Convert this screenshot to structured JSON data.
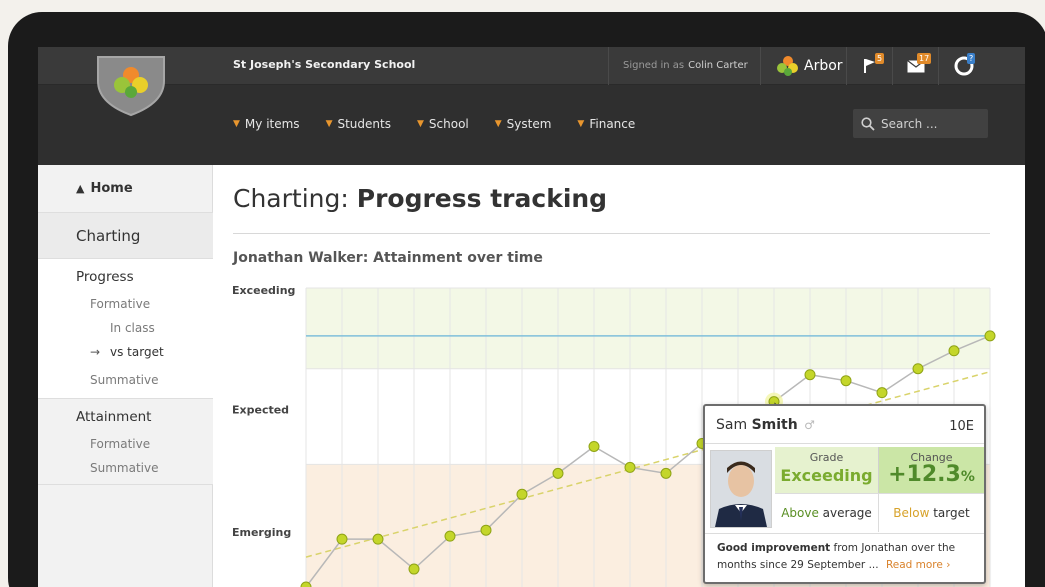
{
  "header": {
    "school_name": "St Joseph's Secondary School",
    "signed_in_label": "Signed in as",
    "user_name": "Colin Carter",
    "brand": "Arbor",
    "flag_count": "5",
    "mail_count": "17",
    "help_badge": "?"
  },
  "nav": {
    "items": [
      "My items",
      "Students",
      "School",
      "System",
      "Finance"
    ],
    "search_placeholder": "Search ..."
  },
  "sidebar": {
    "home": "Home",
    "section": "Charting",
    "progress": "Progress",
    "formative": "Formative",
    "in_class": "In class",
    "vs_target": "vs target",
    "summative": "Summative",
    "attainment": "Attainment",
    "attainment_formative": "Formative",
    "attainment_summative": "Summative"
  },
  "main": {
    "title_prefix": "Charting:",
    "title_bold": "Progress tracking",
    "chart_title": "Jonathan Walker: Attainment over time"
  },
  "chart_data": {
    "type": "line",
    "y_labels": [
      "Exceeding",
      "Expected",
      "Emerging"
    ],
    "ylim": [
      0,
      100
    ],
    "bands": [
      {
        "name": "Exceeding",
        "from": 73,
        "to": 100,
        "color": "#f3f8e6"
      },
      {
        "name": "Expected",
        "from": 41,
        "to": 73,
        "color": "#ffffff"
      },
      {
        "name": "Emerging",
        "from": 0,
        "to": 41,
        "color": "#fbeee0"
      }
    ],
    "target_line": 84,
    "x": [
      0,
      1,
      2,
      3,
      4,
      5,
      6,
      7,
      8,
      9,
      10,
      11,
      12,
      13,
      14,
      15,
      16,
      17,
      18
    ],
    "values": [
      0,
      16,
      16,
      6,
      17,
      19,
      31,
      38,
      47,
      40,
      38,
      48,
      55,
      62,
      71,
      69,
      65,
      73,
      79,
      84
    ],
    "highlight_index": 13,
    "trend": {
      "start": 10,
      "end": 72
    },
    "colors": {
      "point": "#c4d62a",
      "point_stroke": "#8fa316",
      "line": "#b8b8b8",
      "target": "#7fbfdb",
      "trend": "#d9d36a"
    }
  },
  "popup": {
    "first_name": "Sam",
    "last_name": "Smith",
    "gender_symbol": "♂",
    "class": "10E",
    "grade_label": "Grade",
    "grade_value": "Exceeding",
    "change_label": "Change",
    "change_value": "+12.3",
    "change_unit": "%",
    "avg_emph": "Above",
    "avg_rest": "average",
    "target_emph": "Below",
    "target_rest": "target",
    "summary_bold": "Good improvement",
    "summary_rest": "from Jonathan over the months since 29 September ...",
    "read_more": "Read more ›"
  }
}
